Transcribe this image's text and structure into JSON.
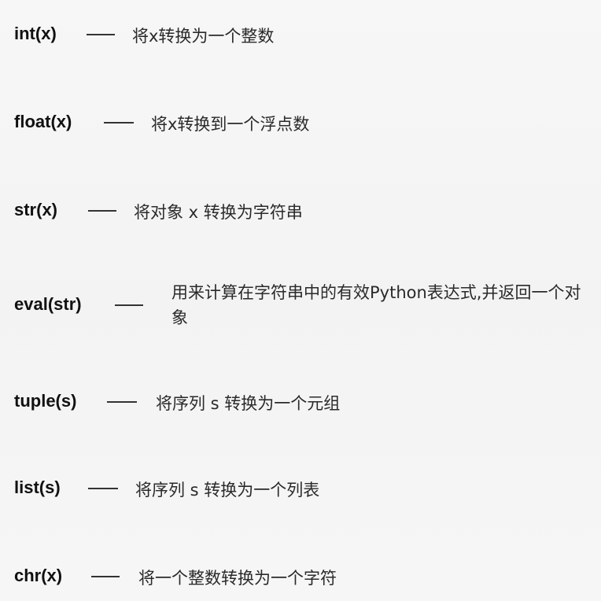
{
  "conversions": [
    {
      "func": "int(x)",
      "desc": "将x转换为一个整数"
    },
    {
      "func": "float(x)",
      "desc": "将x转换到一个浮点数"
    },
    {
      "func": "str(x)",
      "desc": "将对象 x 转换为字符串"
    },
    {
      "func": "eval(str)",
      "desc": "用来计算在字符串中的有效Python表达式,并返回一个对象"
    },
    {
      "func": "tuple(s)",
      "desc": "将序列 s 转换为一个元组"
    },
    {
      "func": "list(s)",
      "desc": "将序列 s 转换为一个列表"
    },
    {
      "func": "chr(x)",
      "desc": "将一个整数转换为一个字符"
    }
  ]
}
